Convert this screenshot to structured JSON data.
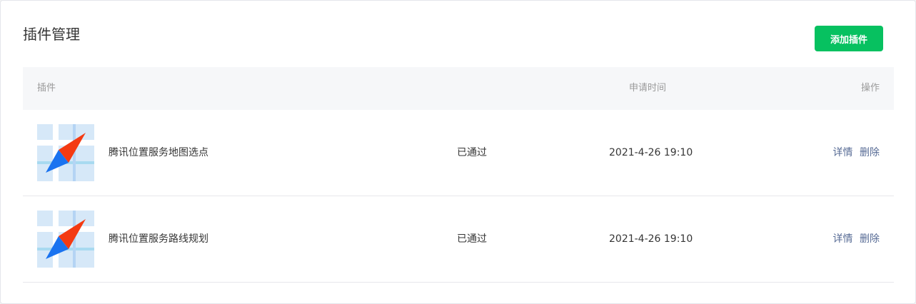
{
  "page": {
    "title": "插件管理",
    "add_button_label": "添加插件",
    "accent_color": "#07c160",
    "link_color": "#576b95"
  },
  "table": {
    "columns": {
      "plugin": "插件",
      "time": "申请时间",
      "action": "操作"
    },
    "rows": [
      {
        "icon": "map-compass-icon",
        "name": "腾讯位置服务地图选点",
        "status": "已通过",
        "time": "2021-4-26 19:10",
        "detail_label": "详情",
        "delete_label": "删除"
      },
      {
        "icon": "map-compass-icon",
        "name": "腾讯位置服务路线规划",
        "status": "已通过",
        "time": "2021-4-26 19:10",
        "detail_label": "详情",
        "delete_label": "删除"
      }
    ]
  }
}
